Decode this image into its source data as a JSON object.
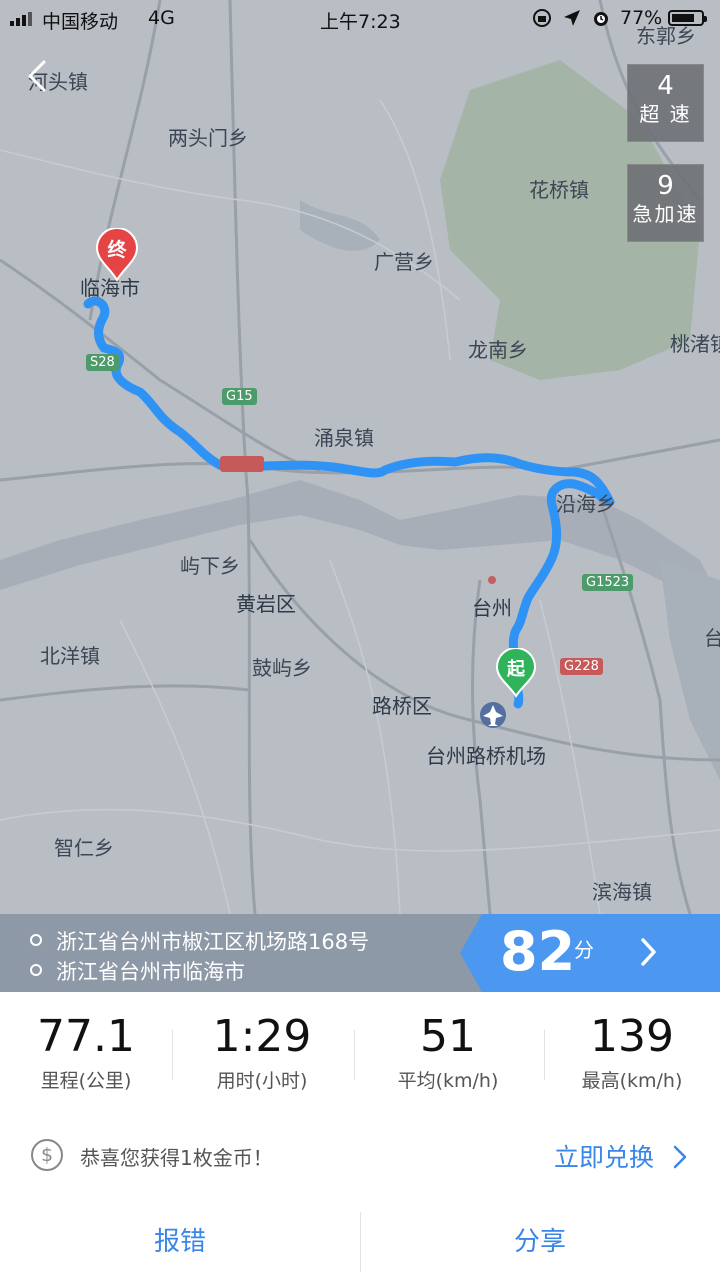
{
  "status_bar": {
    "carrier": "中国移动",
    "network": "4G",
    "time": "上午7:23",
    "battery": "77%",
    "battery_level": 0.77
  },
  "map": {
    "places": {
      "a": "河头镇",
      "b": "两头门乡",
      "c": "东郭乡",
      "d": "花桥镇",
      "e": "广营乡",
      "f": "临海市",
      "g": "龙南乡",
      "h": "桃渚镇",
      "i": "涌泉镇",
      "j": "沿海乡",
      "k": "屿下乡",
      "l": "台州",
      "m": "黄岩区",
      "n": "北洋镇",
      "o": "鼓屿乡",
      "p": "路桥区",
      "q": "台州路桥机场",
      "r": "智仁乡",
      "s": "滨海镇",
      "t": "台"
    },
    "roads": {
      "s28": "S28",
      "g15": "G15",
      "g1523": "G1523",
      "g228": "G228"
    },
    "end_pin": "终",
    "start_pin": "起"
  },
  "event_stats": [
    {
      "count": "4",
      "label": "超 速"
    },
    {
      "count": "9",
      "label": "急加速"
    }
  ],
  "route": {
    "from": "浙江省台州市椒江区机场路168号",
    "to": "浙江省台州市临海市"
  },
  "score": {
    "value": "82",
    "unit": "分"
  },
  "trip_stats": [
    {
      "value": "77.1",
      "label": "里程(公里)"
    },
    {
      "value": "1:29",
      "label": "用时(小时)"
    },
    {
      "value": "51",
      "label": "平均(km/h)"
    },
    {
      "value": "139",
      "label": "最高(km/h)"
    }
  ],
  "coin": {
    "icon": "$",
    "message": "恭喜您获得1枚金币！",
    "action": "立即兑换"
  },
  "bottom": {
    "report": "报错",
    "share": "分享"
  }
}
